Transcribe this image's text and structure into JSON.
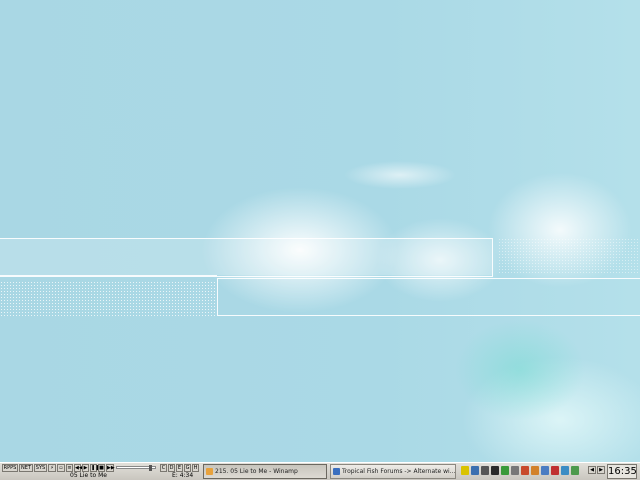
{
  "taskbar": {
    "quick_buttons": [
      "RPPS",
      "NET",
      "SYS"
    ],
    "winamp": {
      "track_label": "05 Lie to Me",
      "elapsed": "E: 4:34",
      "slider_position": 0.9,
      "eq_buttons": [
        "C",
        "D",
        "E",
        "G",
        "H"
      ]
    },
    "tasks": [
      {
        "label": "215. 05 Lie to Me - Winamp",
        "icon": "winamp-icon",
        "icon_color": "#e8a23c"
      },
      {
        "label": "Tropical Fish Forums -> Alternate wi...",
        "icon": "browser-icon",
        "icon_color": "#3a6fbf"
      }
    ],
    "tray_icons": [
      {
        "name": "hand-icon",
        "color": "#d9c300"
      },
      {
        "name": "network-icon",
        "color": "#3b6fb0"
      },
      {
        "name": "volume-icon",
        "color": "#555555"
      },
      {
        "name": "monitor-icon",
        "color": "#2a2a2a"
      },
      {
        "name": "chart-icon",
        "color": "#3a9a3a"
      },
      {
        "name": "printer-icon",
        "color": "#777777"
      },
      {
        "name": "shield-icon",
        "color": "#c84a2c"
      },
      {
        "name": "pencil-icon",
        "color": "#d2812a"
      },
      {
        "name": "mail-icon",
        "color": "#4a7cc2"
      },
      {
        "name": "flag-icon",
        "color": "#c03030"
      },
      {
        "name": "globe-icon",
        "color": "#3b8cc4"
      },
      {
        "name": "settings-icon",
        "color": "#4d9a4d"
      }
    ],
    "extra_tray": [
      "◀",
      "▶"
    ],
    "clock": "16:35"
  }
}
